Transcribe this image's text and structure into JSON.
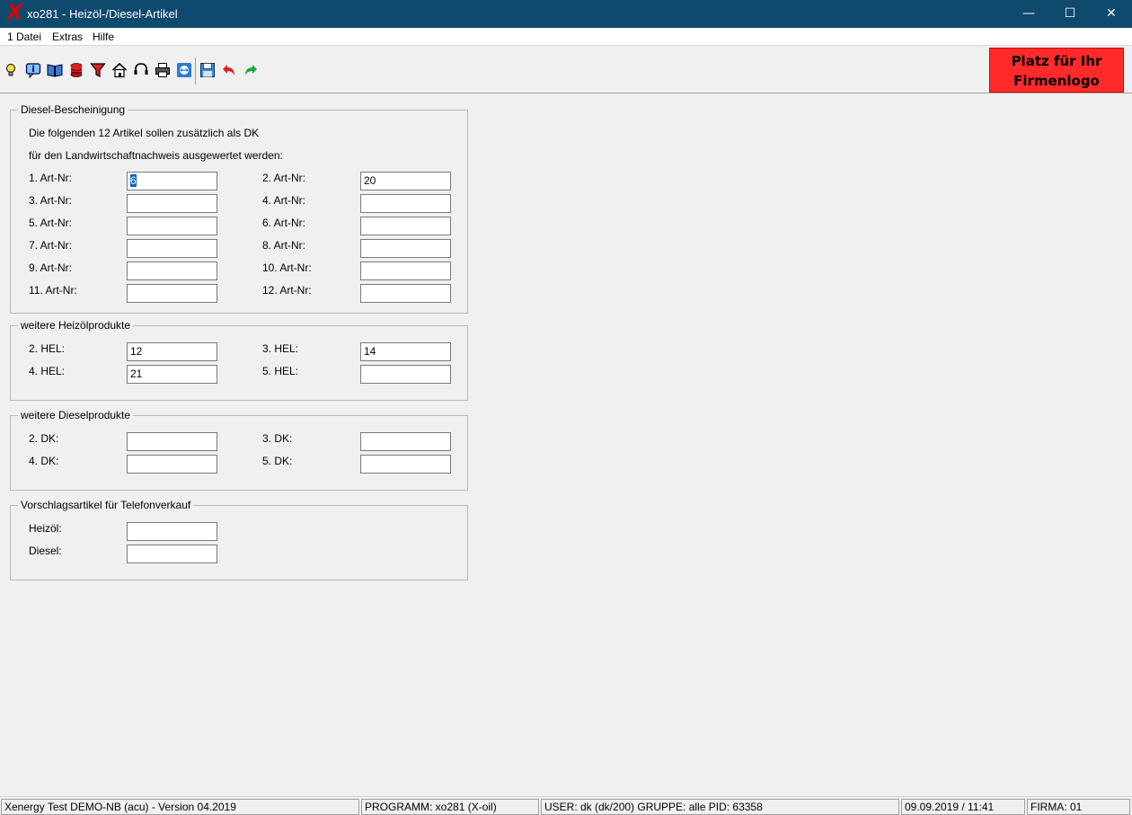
{
  "window": {
    "title": "xo281 - Heizöl-/Diesel-Artikel",
    "minimize": "—",
    "maximize": "☐",
    "close": "✕",
    "app_icon": "X"
  },
  "menu": [
    "1 Datei",
    "Extras",
    "Hilfe"
  ],
  "toolbar": {
    "icons": [
      "lightbulb-icon",
      "info-icon",
      "book-icon",
      "database-icon",
      "filter-icon",
      "home-icon",
      "headset-icon",
      "print-icon",
      "remote-icon",
      "save-icon",
      "undo-icon",
      "redo-icon"
    ],
    "logo_line1": "Platz für Ihr",
    "logo_line2": "Firmenlogo"
  },
  "diesel": {
    "legend": "Diesel-Bescheinigung",
    "text1": "Die folgenden 12 Artikel sollen zusätzlich als DK",
    "text2": "für den Landwirtschaftnachweis ausgewertet werden:",
    "fields": [
      {
        "label": "1. Art-Nr:",
        "value": "6"
      },
      {
        "label": "2. Art-Nr:",
        "value": "20"
      },
      {
        "label": "3. Art-Nr:",
        "value": ""
      },
      {
        "label": "4. Art-Nr:",
        "value": ""
      },
      {
        "label": "5. Art-Nr:",
        "value": ""
      },
      {
        "label": "6. Art-Nr:",
        "value": ""
      },
      {
        "label": "7. Art-Nr:",
        "value": ""
      },
      {
        "label": "8. Art-Nr:",
        "value": ""
      },
      {
        "label": "9. Art-Nr:",
        "value": ""
      },
      {
        "label": "10. Art-Nr:",
        "value": ""
      },
      {
        "label": "11. Art-Nr:",
        "value": ""
      },
      {
        "label": "12. Art-Nr:",
        "value": ""
      }
    ]
  },
  "heizoel": {
    "legend": "weitere Heizölprodukte",
    "fields": [
      {
        "label": "2. HEL:",
        "value": "12"
      },
      {
        "label": "3. HEL:",
        "value": "14"
      },
      {
        "label": "4. HEL:",
        "value": "21"
      },
      {
        "label": "5. HEL:",
        "value": ""
      }
    ]
  },
  "dieselprod": {
    "legend": "weitere Dieselprodukte",
    "fields": [
      {
        "label": "2. DK:",
        "value": ""
      },
      {
        "label": "3. DK:",
        "value": ""
      },
      {
        "label": "4. DK:",
        "value": ""
      },
      {
        "label": "5. DK:",
        "value": ""
      }
    ]
  },
  "telefon": {
    "legend": "Vorschlagsartikel für Telefonverkauf",
    "fields": [
      {
        "label": "Heizöl:",
        "value": ""
      },
      {
        "label": "Diesel:",
        "value": ""
      }
    ]
  },
  "status": {
    "version": "Xenergy Test DEMO-NB (acu) - Version 04.2019",
    "program": "PROGRAMM: xo281 (X-oil)",
    "user": "USER: dk (dk/200)  GRUPPE: alle  PID: 63358",
    "datetime": "09.09.2019 / 11:41",
    "firma": "FIRMA: 01"
  },
  "colors": {
    "titlebar": "#0e4a6e",
    "logo_bg": "#ff2a2a",
    "selection": "#0a64c8"
  }
}
